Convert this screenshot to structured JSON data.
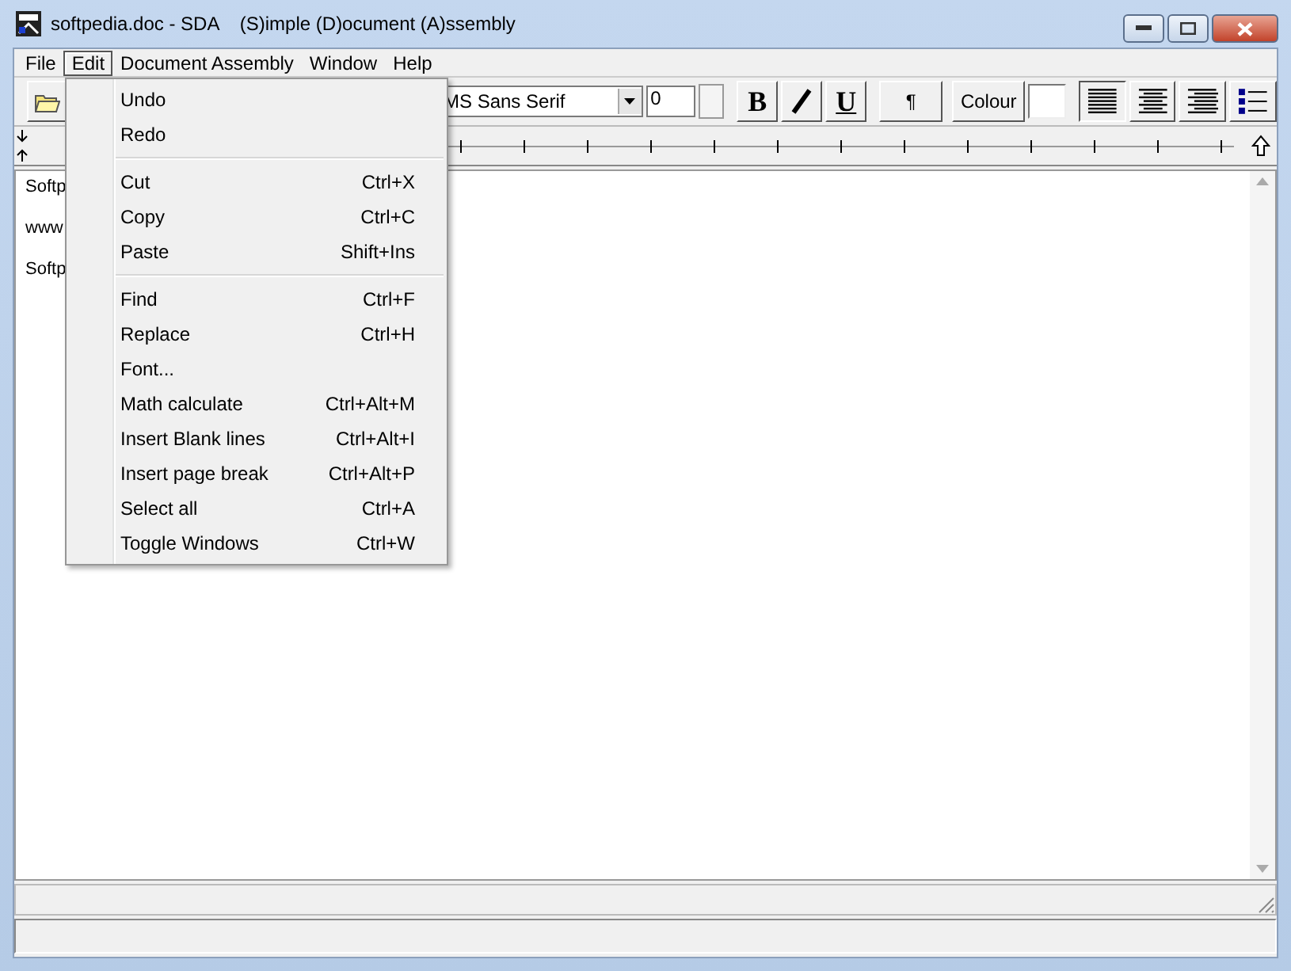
{
  "window": {
    "title": "softpedia.doc - SDA    (S)imple (D)ocument (A)ssembly"
  },
  "menu_bar": [
    {
      "label": "File",
      "selected": false
    },
    {
      "label": "Edit",
      "selected": true
    },
    {
      "label": "Document Assembly",
      "selected": false
    },
    {
      "label": "Window",
      "selected": false
    },
    {
      "label": "Help",
      "selected": false
    }
  ],
  "edit_menu": [
    {
      "kind": "item",
      "label": "Undo"
    },
    {
      "kind": "item",
      "label": "Redo"
    },
    {
      "kind": "separator"
    },
    {
      "kind": "item",
      "label": "Cut",
      "shortcut": "Ctrl+X"
    },
    {
      "kind": "item",
      "label": "Copy",
      "shortcut": "Ctrl+C"
    },
    {
      "kind": "item",
      "label": "Paste",
      "shortcut": "Shift+Ins"
    },
    {
      "kind": "separator"
    },
    {
      "kind": "item",
      "label": "Find",
      "shortcut": "Ctrl+F"
    },
    {
      "kind": "item",
      "label": "Replace",
      "shortcut": "Ctrl+H"
    },
    {
      "kind": "item",
      "label": "Font..."
    },
    {
      "kind": "item",
      "label": "Math calculate",
      "shortcut": "Ctrl+Alt+M"
    },
    {
      "kind": "item",
      "label": "Insert Blank lines",
      "shortcut": "Ctrl+Alt+I"
    },
    {
      "kind": "item",
      "label": "Insert page break",
      "shortcut": "Ctrl+Alt+P"
    },
    {
      "kind": "item",
      "label": "Select all",
      "shortcut": "Ctrl+A"
    },
    {
      "kind": "item",
      "label": "Toggle Windows",
      "shortcut": "Ctrl+W"
    }
  ],
  "toolbar": {
    "font": "MS Sans Serif",
    "size": "0",
    "bold": "B",
    "underline": "U",
    "paragraph": "¶",
    "colour": "Colour",
    "alignment": [
      {
        "kind": "left",
        "selected": true
      },
      {
        "kind": "center",
        "selected": false
      },
      {
        "kind": "right",
        "selected": false
      },
      {
        "kind": "bullets",
        "selected": false
      }
    ]
  },
  "document": {
    "lines": [
      "Softp",
      "www",
      "Softp"
    ]
  }
}
